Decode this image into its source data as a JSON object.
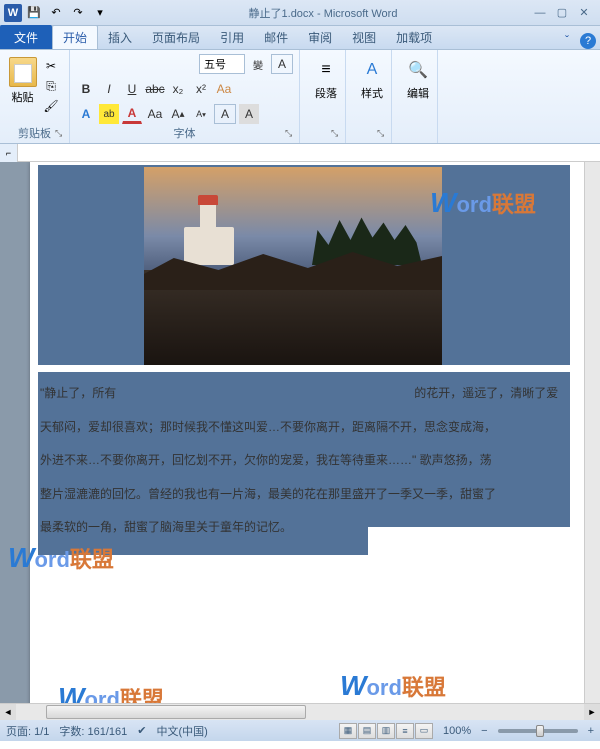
{
  "title": "静止了1.docx - Microsoft Word",
  "tabs": {
    "file": "文件",
    "home": "开始",
    "insert": "插入",
    "layout": "页面布局",
    "ref": "引用",
    "mail": "邮件",
    "review": "审阅",
    "view": "视图",
    "addin": "加载项"
  },
  "ribbon": {
    "clipboard": {
      "label": "剪贴板",
      "paste": "粘贴"
    },
    "font": {
      "label": "字体",
      "size": "五号"
    },
    "para": {
      "label": "段落",
      "btn": "段落"
    },
    "style": {
      "label": "样式",
      "btn": "样式"
    },
    "edit": {
      "label": "编辑",
      "btn": "编辑"
    }
  },
  "doc": {
    "line1a": "\"静止了，所有",
    "line1b": "的花开，遥远了，清晰了爱",
    "line2": "天郁闷，爱却很喜欢；那时候我不懂这叫爱…不要你离开，距离隔不开，思念变成海，",
    "line3": "外进不来…不要你离开，回忆划不开，欠你的宠爱，我在等待重来……\"   歌声悠扬，荡",
    "line4": "整片湿漉漉的回忆。曾经的我也有一片海，最美的花在那里盛开了一季又一季，甜蜜了",
    "line5": "最柔软的一角，甜蜜了脑海里关于童年的记忆。"
  },
  "status": {
    "page": "页面: 1/1",
    "words": "字数: 161/161",
    "lang": "中文(中国)",
    "zoom": "100%",
    "zminus": "−",
    "zplus": "+"
  },
  "watermark": {
    "w": "W",
    "ord": "ord",
    "cn": "联盟"
  }
}
